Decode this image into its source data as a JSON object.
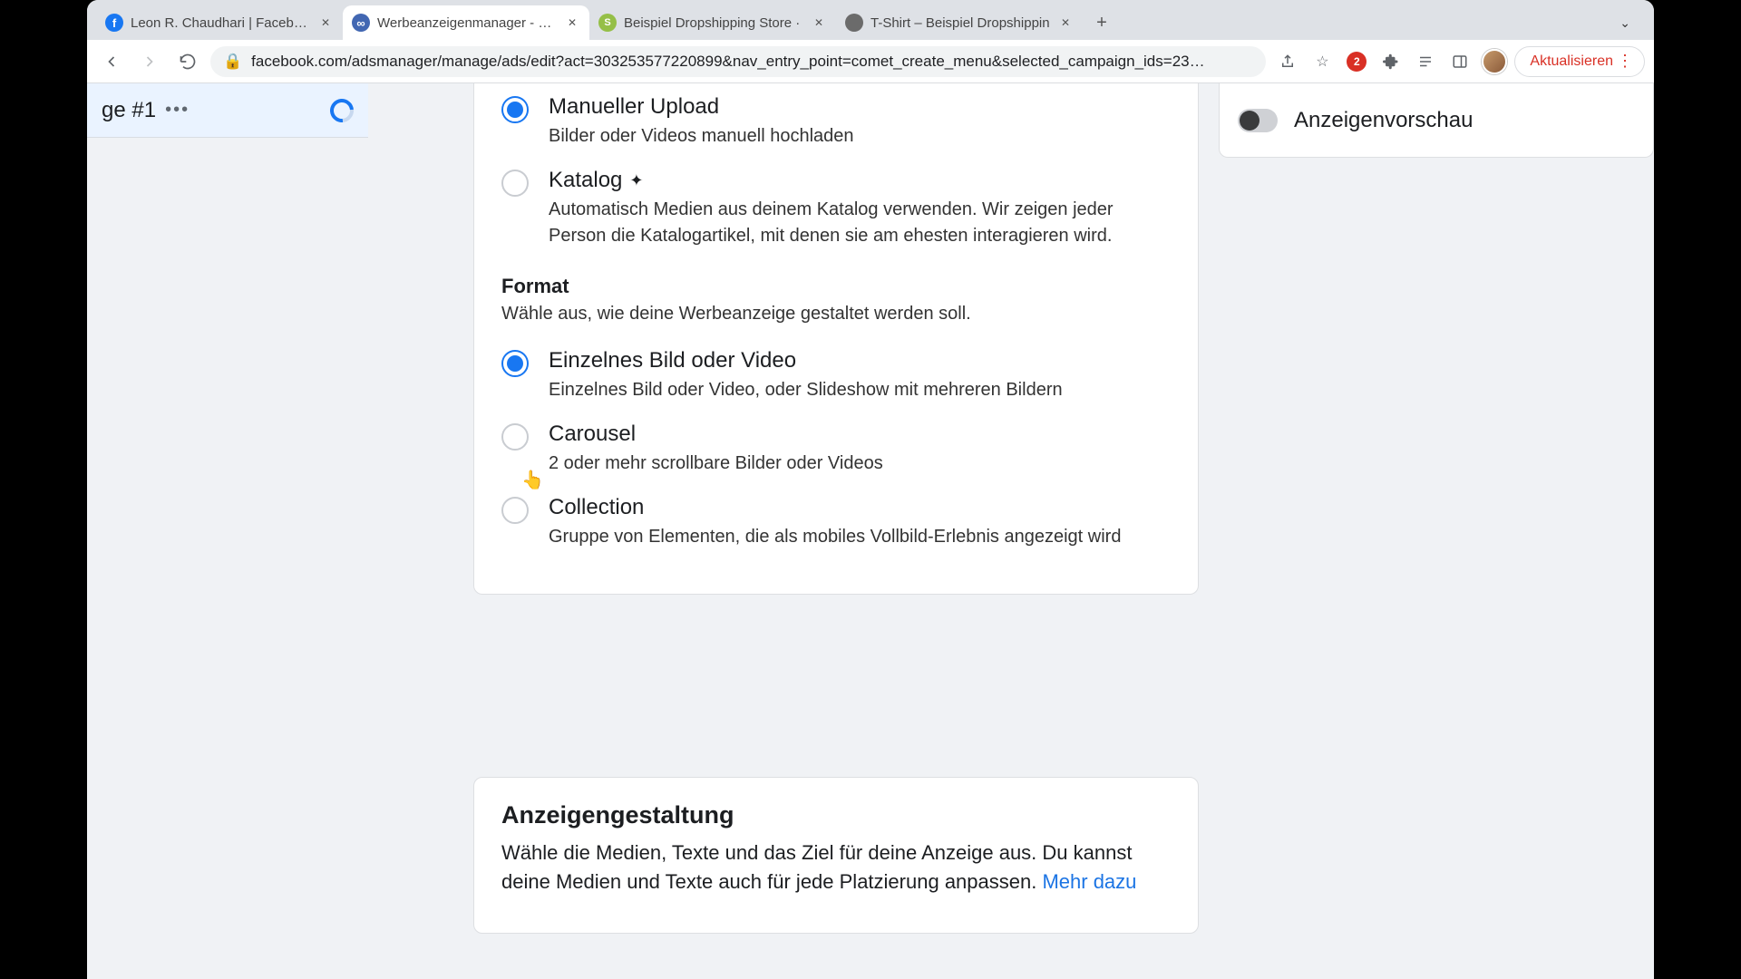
{
  "tabs": [
    {
      "label": "Leon R. Chaudhari | Facebook",
      "fav": "f"
    },
    {
      "label": "Werbeanzeigenmanager - Wer",
      "fav": "meta"
    },
    {
      "label": "Beispiel Dropshipping Store ·",
      "fav": "shop"
    },
    {
      "label": "T-Shirt – Beispiel Dropshippin",
      "fav": "grey"
    }
  ],
  "url": "facebook.com/adsmanager/manage/ads/edit?act=303253577220899&nav_entry_point=comet_create_menu&selected_campaign_ids=23…",
  "ext_badge": "2",
  "update_label": "Aktualisieren",
  "sidebar_item": "ge #1",
  "media_source": {
    "manual": {
      "title": "Manueller Upload",
      "desc": "Bilder oder Videos manuell hochladen"
    },
    "catalog": {
      "title": "Katalog",
      "desc": "Automatisch Medien aus deinem Katalog verwenden. Wir zeigen jeder Person die Katalogartikel, mit denen sie am ehesten interagieren wird."
    }
  },
  "format": {
    "heading": "Format",
    "desc": "Wähle aus, wie deine Werbeanzeige gestaltet werden soll.",
    "single": {
      "title": "Einzelnes Bild oder Video",
      "desc": "Einzelnes Bild oder Video, oder Slideshow mit mehreren Bildern"
    },
    "carousel": {
      "title": "Carousel",
      "desc": "2 oder mehr scrollbare Bilder oder Videos"
    },
    "collection": {
      "title": "Collection",
      "desc": "Gruppe von Elementen, die als mobiles Vollbild-Erlebnis angezeigt wird"
    }
  },
  "creative": {
    "heading": "Anzeigengestaltung",
    "desc": "Wähle die Medien, Texte und das Ziel für deine Anzeige aus. Du kannst deine Medien und Texte auch für jede Platzierung anpassen. ",
    "more": "Mehr dazu"
  },
  "preview_label": "Anzeigenvorschau"
}
